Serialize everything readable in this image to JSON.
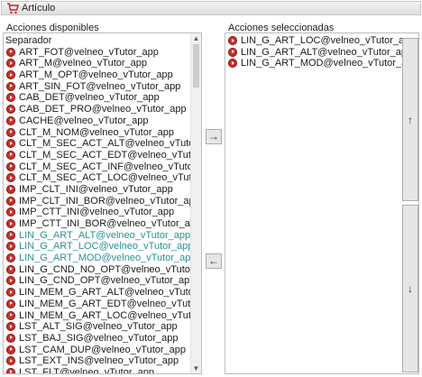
{
  "window": {
    "title": "Artículo",
    "icon": "cart-icon"
  },
  "left": {
    "label": "Acciones disponibles",
    "separator": "Separador",
    "items": [
      {
        "text": "ART_FOT@velneo_vTutor_app",
        "hl": false
      },
      {
        "text": "ART_M@velneo_vTutor_app",
        "hl": false
      },
      {
        "text": "ART_M_OPT@velneo_vTutor_app",
        "hl": false
      },
      {
        "text": "ART_SIN_FOT@velneo_vTutor_app",
        "hl": false
      },
      {
        "text": "CAB_DET@velneo_vTutor_app",
        "hl": false
      },
      {
        "text": "CAB_DET_PRO@velneo_vTutor_app",
        "hl": false
      },
      {
        "text": "CACHE@velneo_vTutor_app",
        "hl": false
      },
      {
        "text": "CLT_M_NOM@velneo_vTutor_app",
        "hl": false
      },
      {
        "text": "CLT_M_SEC_ACT_ALT@velneo_vTutor_app",
        "hl": false
      },
      {
        "text": "CLT_M_SEC_ACT_EDT@velneo_vTutor_app",
        "hl": false
      },
      {
        "text": "CLT_M_SEC_ACT_INF@velneo_vTutor_app",
        "hl": false
      },
      {
        "text": "CLT_M_SEC_ACT_LOC@velneo_vTutor_app",
        "hl": false
      },
      {
        "text": "IMP_CLT_INI@velneo_vTutor_app",
        "hl": false
      },
      {
        "text": "IMP_CLT_INI_BOR@velneo_vTutor_app",
        "hl": false
      },
      {
        "text": "IMP_CTT_INI@velneo_vTutor_app",
        "hl": false
      },
      {
        "text": "IMP_CTT_INI_BOR@velneo_vTutor_app",
        "hl": false
      },
      {
        "text": "LIN_G_ART_ALT@velneo_vTutor_app",
        "hl": true
      },
      {
        "text": "LIN_G_ART_LOC@velneo_vTutor_app",
        "hl": true
      },
      {
        "text": "LIN_G_ART_MOD@velneo_vTutor_app",
        "hl": true
      },
      {
        "text": "LIN_G_CND_NO_OPT@velneo_vTutor_app",
        "hl": false
      },
      {
        "text": "LIN_G_CND_OPT@velneo_vTutor_app",
        "hl": false
      },
      {
        "text": "LIN_MEM_G_ART_ALT@velneo_vTutor_app",
        "hl": false
      },
      {
        "text": "LIN_MEM_G_ART_EDT@velneo_vTutor_app",
        "hl": false
      },
      {
        "text": "LIN_MEM_G_ART_LOC@velneo_vTutor_app",
        "hl": false
      },
      {
        "text": "LST_ALT_SIG@velneo_vTutor_app",
        "hl": false
      },
      {
        "text": "LST_BAJ_SIG@velneo_vTutor_app",
        "hl": false
      },
      {
        "text": "LST_CAM_DUP@velneo_vTutor_app",
        "hl": false
      },
      {
        "text": "LST_EXT_INS@velneo_vTutor_app",
        "hl": false
      },
      {
        "text": "LST_FLT@velneo_vTutor_app",
        "hl": false
      }
    ]
  },
  "right": {
    "label": "Acciones seleccionadas",
    "items": [
      "LIN_G_ART_LOC@velneo_vTutor_app",
      "LIN_G_ART_ALT@velneo_vTutor_app",
      "LIN_G_ART_MOD@velneo_vTutor_app"
    ]
  },
  "buttons": {
    "add": "→",
    "remove": "←",
    "up": "↑",
    "down": "↓"
  },
  "scrollbar": {
    "up": "▲",
    "down": "▼"
  },
  "colors": {
    "action_icon": "#c8312d",
    "highlight_text": "#2b8f9a"
  }
}
